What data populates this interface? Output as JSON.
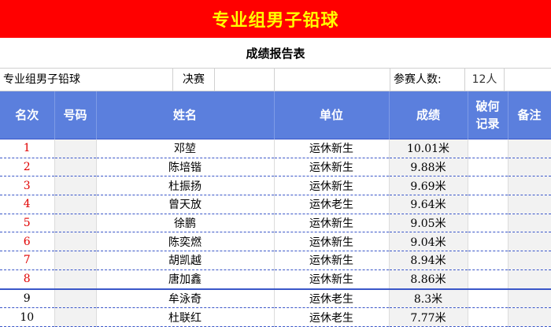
{
  "title": "专业组男子铅球",
  "subtitle": "成绩报告表",
  "info": {
    "event": "专业组男子铅球",
    "stage": "决赛",
    "participants_label": "参赛人数:",
    "participants_value": "12人"
  },
  "headers": {
    "rank": "名次",
    "number": "号码",
    "name": "姓名",
    "unit": "单位",
    "score": "成绩",
    "record_line1": "破何",
    "record_line2": "记录",
    "remark": "备注"
  },
  "rows": [
    {
      "rank": "1",
      "number": "",
      "name": "邓堃",
      "unit": "运休新生",
      "score": "10.01米",
      "record": "",
      "remark": ""
    },
    {
      "rank": "2",
      "number": "",
      "name": "陈培锴",
      "unit": "运休新生",
      "score": "9.88米",
      "record": "",
      "remark": ""
    },
    {
      "rank": "3",
      "number": "",
      "name": "杜振扬",
      "unit": "运休新生",
      "score": "9.69米",
      "record": "",
      "remark": ""
    },
    {
      "rank": "4",
      "number": "",
      "name": "曾天放",
      "unit": "运休老生",
      "score": "9.64米",
      "record": "",
      "remark": ""
    },
    {
      "rank": "5",
      "number": "",
      "name": "徐鹏",
      "unit": "运休新生",
      "score": "9.05米",
      "record": "",
      "remark": ""
    },
    {
      "rank": "6",
      "number": "",
      "name": "陈奕燃",
      "unit": "运休新生",
      "score": "9.04米",
      "record": "",
      "remark": ""
    },
    {
      "rank": "7",
      "number": "",
      "name": "胡凯越",
      "unit": "运休新生",
      "score": "8.94米",
      "record": "",
      "remark": ""
    },
    {
      "rank": "8",
      "number": "",
      "name": "唐加鑫",
      "unit": "运休新生",
      "score": "8.86米",
      "record": "",
      "remark": ""
    },
    {
      "rank": "9",
      "number": "",
      "name": "牟泳奇",
      "unit": "运休老生",
      "score": "8.3米",
      "record": "",
      "remark": ""
    },
    {
      "rank": "10",
      "number": "",
      "name": "杜联红",
      "unit": "运休老生",
      "score": "7.77米",
      "record": "",
      "remark": ""
    }
  ],
  "colors": {
    "title_bg": "#ff0000",
    "title_text": "#ffff00",
    "header_bg": "#5b7fdd",
    "top_rank_text": "#e00000"
  }
}
